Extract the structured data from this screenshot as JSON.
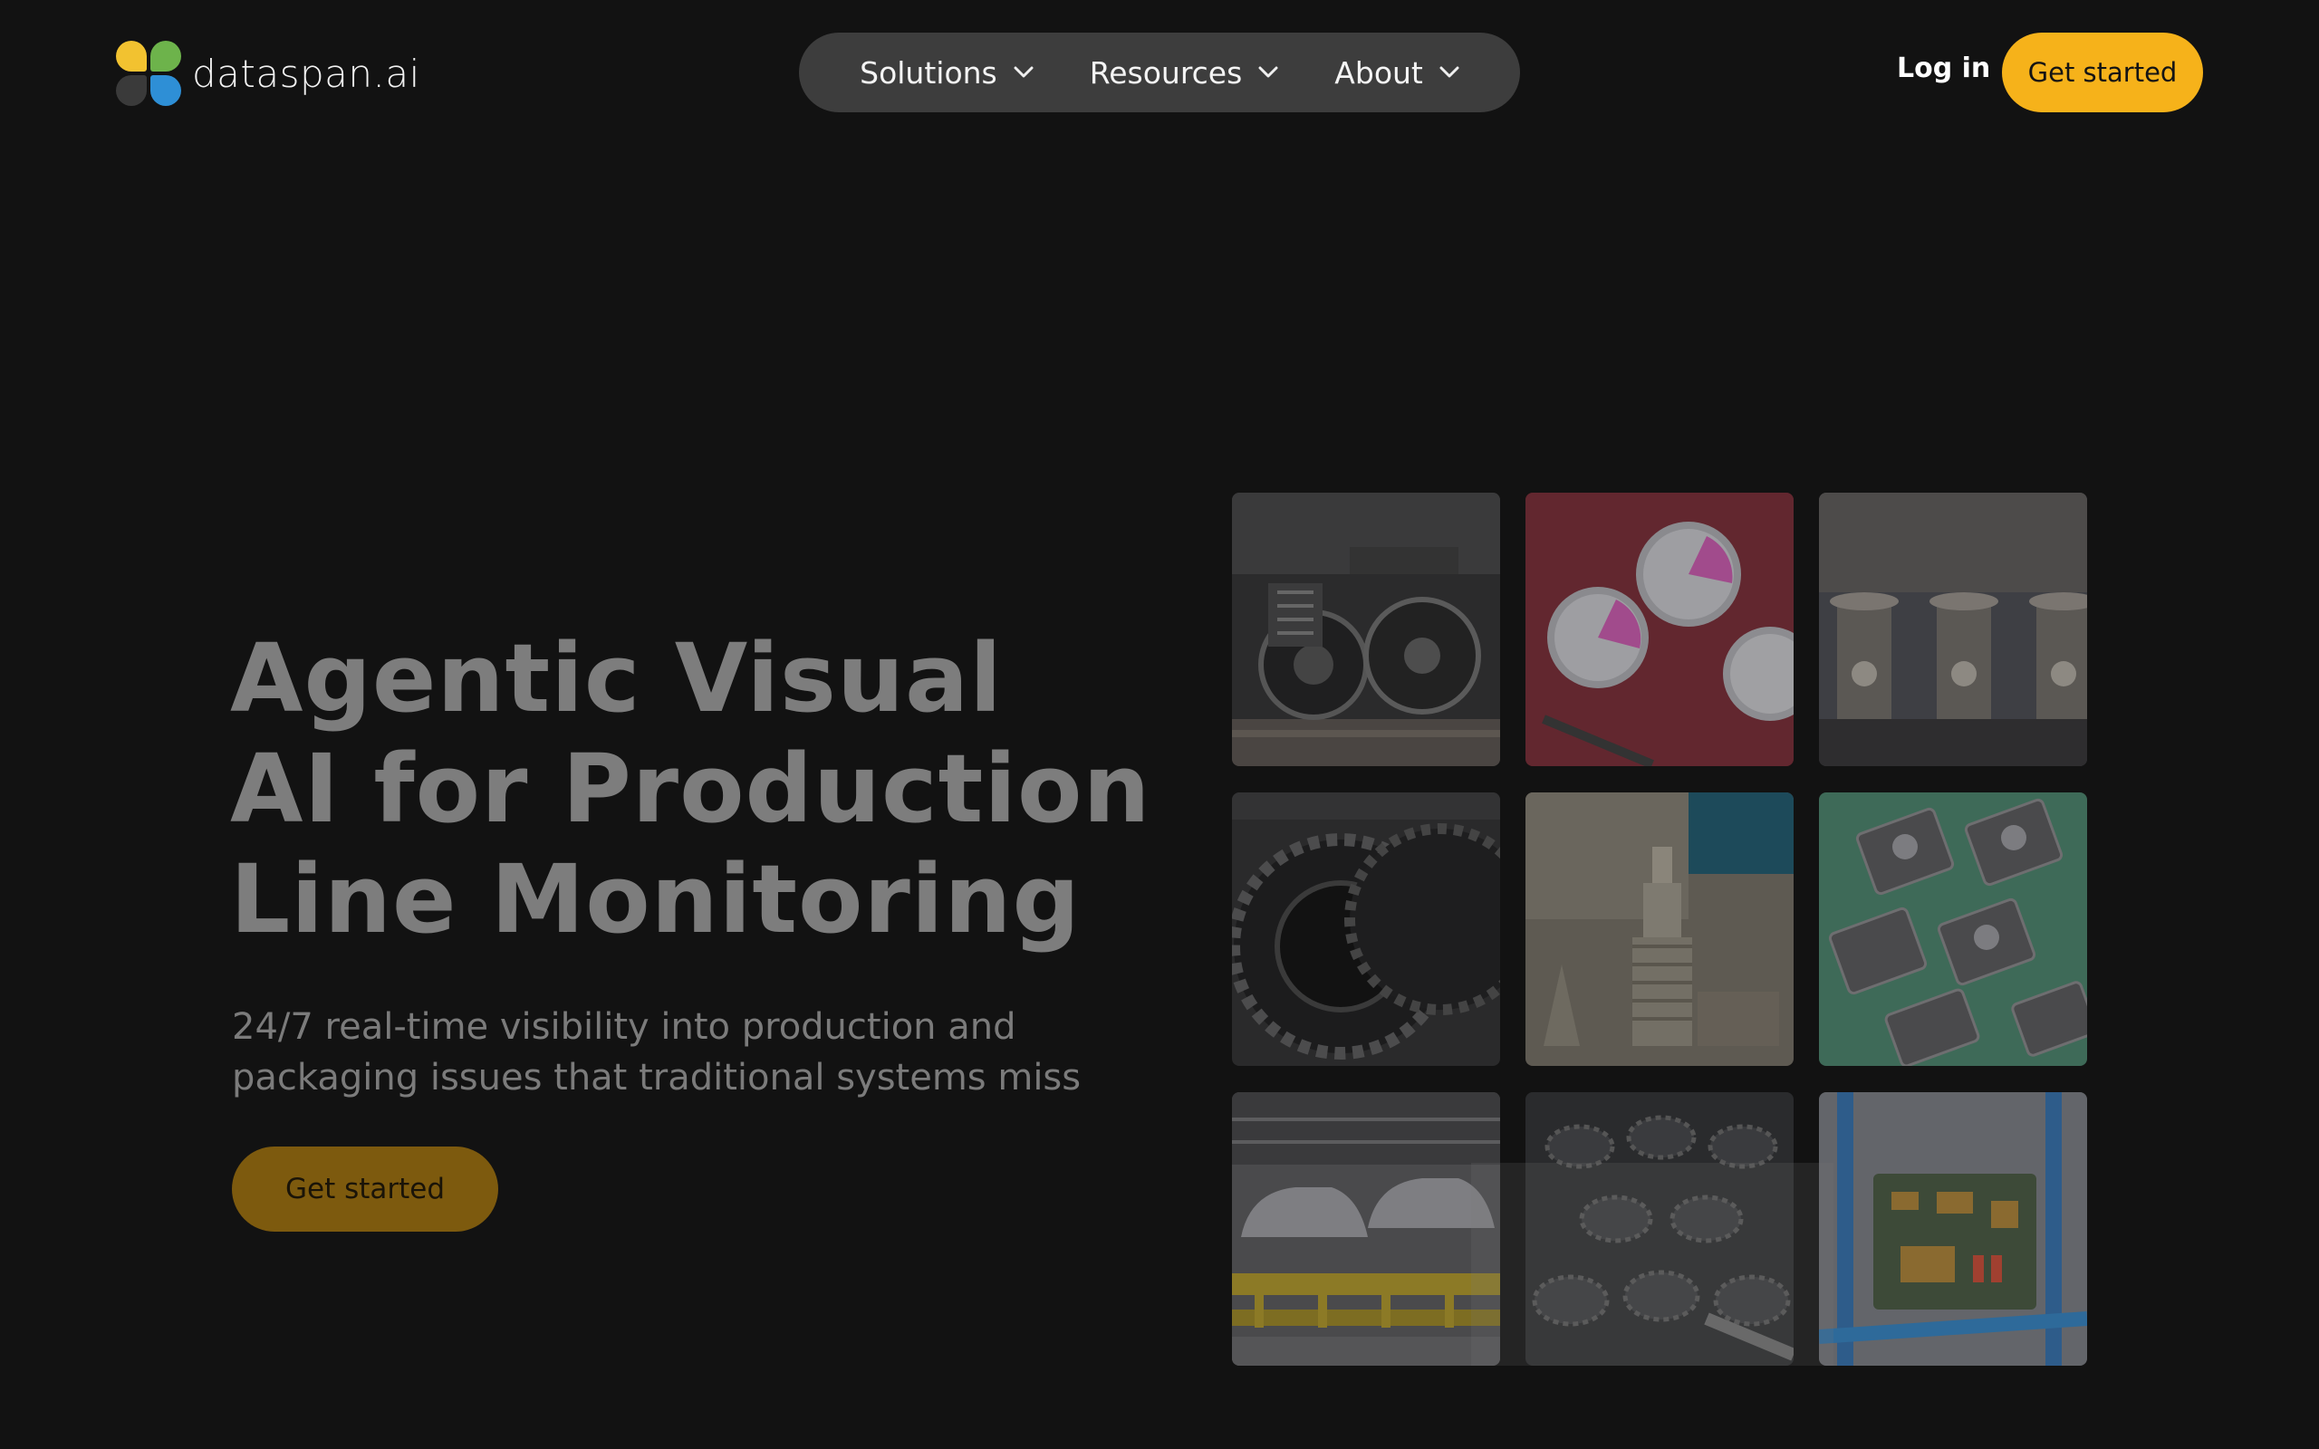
{
  "brand": {
    "name": "dataspan.ai",
    "colors": {
      "yellow": "#f2c230",
      "green": "#6db34b",
      "blue": "#2e8fd6",
      "dark": "#3a3a3a"
    }
  },
  "nav": {
    "items": [
      {
        "label": "Solutions",
        "icon": "chevron-down-icon"
      },
      {
        "label": "Resources",
        "icon": "chevron-down-icon"
      },
      {
        "label": "About",
        "icon": "chevron-down-icon"
      }
    ],
    "login_label": "Log in",
    "cta_label": "Get started"
  },
  "hero": {
    "title_lines": [
      "Agentic Visual",
      "AI for Production",
      "Line Monitoring"
    ],
    "subtitle_lines": [
      "24/7 real-time visibility into production and",
      "packaging issues that traditional systems miss"
    ],
    "cta_label": "Get started"
  },
  "gallery": {
    "tiles": [
      {
        "subject": "train-wheel-bogie"
      },
      {
        "subject": "pcb-capacitors"
      },
      {
        "subject": "valve-fittings-row"
      },
      {
        "subject": "tractor-tires"
      },
      {
        "subject": "stacked-gears"
      },
      {
        "subject": "music-box-mechanisms"
      },
      {
        "subject": "car-assembly-line"
      },
      {
        "subject": "black-gear-rollers"
      },
      {
        "subject": "robot-circuit-board"
      }
    ]
  },
  "accent_color": "#f6b21a"
}
